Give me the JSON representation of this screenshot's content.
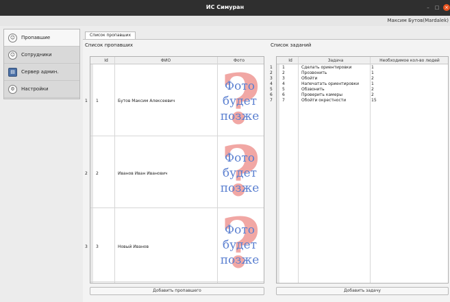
{
  "window": {
    "title": "ИС Симуран",
    "min_glyph": "–",
    "max_glyph": "□",
    "close_glyph": "×"
  },
  "userbar": {
    "user": "Максим Бутов(Mardalek)"
  },
  "sidebar": {
    "items": [
      {
        "label": "Пропавшие",
        "icon": "person-icon"
      },
      {
        "label": "Сотрудники",
        "icon": "person-icon"
      },
      {
        "label": "Сервер админ.",
        "icon": "server-icon"
      },
      {
        "label": "Настройки",
        "icon": "gear-icon"
      }
    ]
  },
  "tab": {
    "label": "Список пропавших"
  },
  "missing": {
    "title": "Список пропавших",
    "columns": [
      "Id",
      "ФИО",
      "Фото"
    ],
    "rows": [
      {
        "row_no": "1",
        "id": "1",
        "name": "Бутов Максим Алексеевич",
        "photo": [
          "Фото",
          "будет",
          "позже"
        ]
      },
      {
        "row_no": "2",
        "id": "2",
        "name": "Иванов Иван Иванович",
        "photo": [
          "Фото",
          "будет",
          "позже"
        ]
      },
      {
        "row_no": "3",
        "id": "3",
        "name": "Новый Иванов",
        "photo": [
          "Фото",
          "будет",
          "позже"
        ]
      }
    ],
    "add_button": "Добавить пропавшего"
  },
  "tasks": {
    "title": "Список заданий",
    "columns": [
      "Id",
      "Задача",
      "Необходимое кол-во людей"
    ],
    "rows": [
      {
        "row_no": "1",
        "id": "1",
        "task": "Сделать ориентировки",
        "people": "1"
      },
      {
        "row_no": "2",
        "id": "2",
        "task": "Прозвонить",
        "people": "1"
      },
      {
        "row_no": "3",
        "id": "3",
        "task": "Обойти",
        "people": "2"
      },
      {
        "row_no": "4",
        "id": "4",
        "task": "Напечатать ориентировки",
        "people": "1"
      },
      {
        "row_no": "5",
        "id": "5",
        "task": "Обзвонить",
        "people": "2"
      },
      {
        "row_no": "6",
        "id": "6",
        "task": "Проверить камеры",
        "people": "2"
      },
      {
        "row_no": "7",
        "id": "7",
        "task": "Обойти окрестности",
        "people": "15"
      }
    ],
    "add_button": "Добавить задачу"
  }
}
